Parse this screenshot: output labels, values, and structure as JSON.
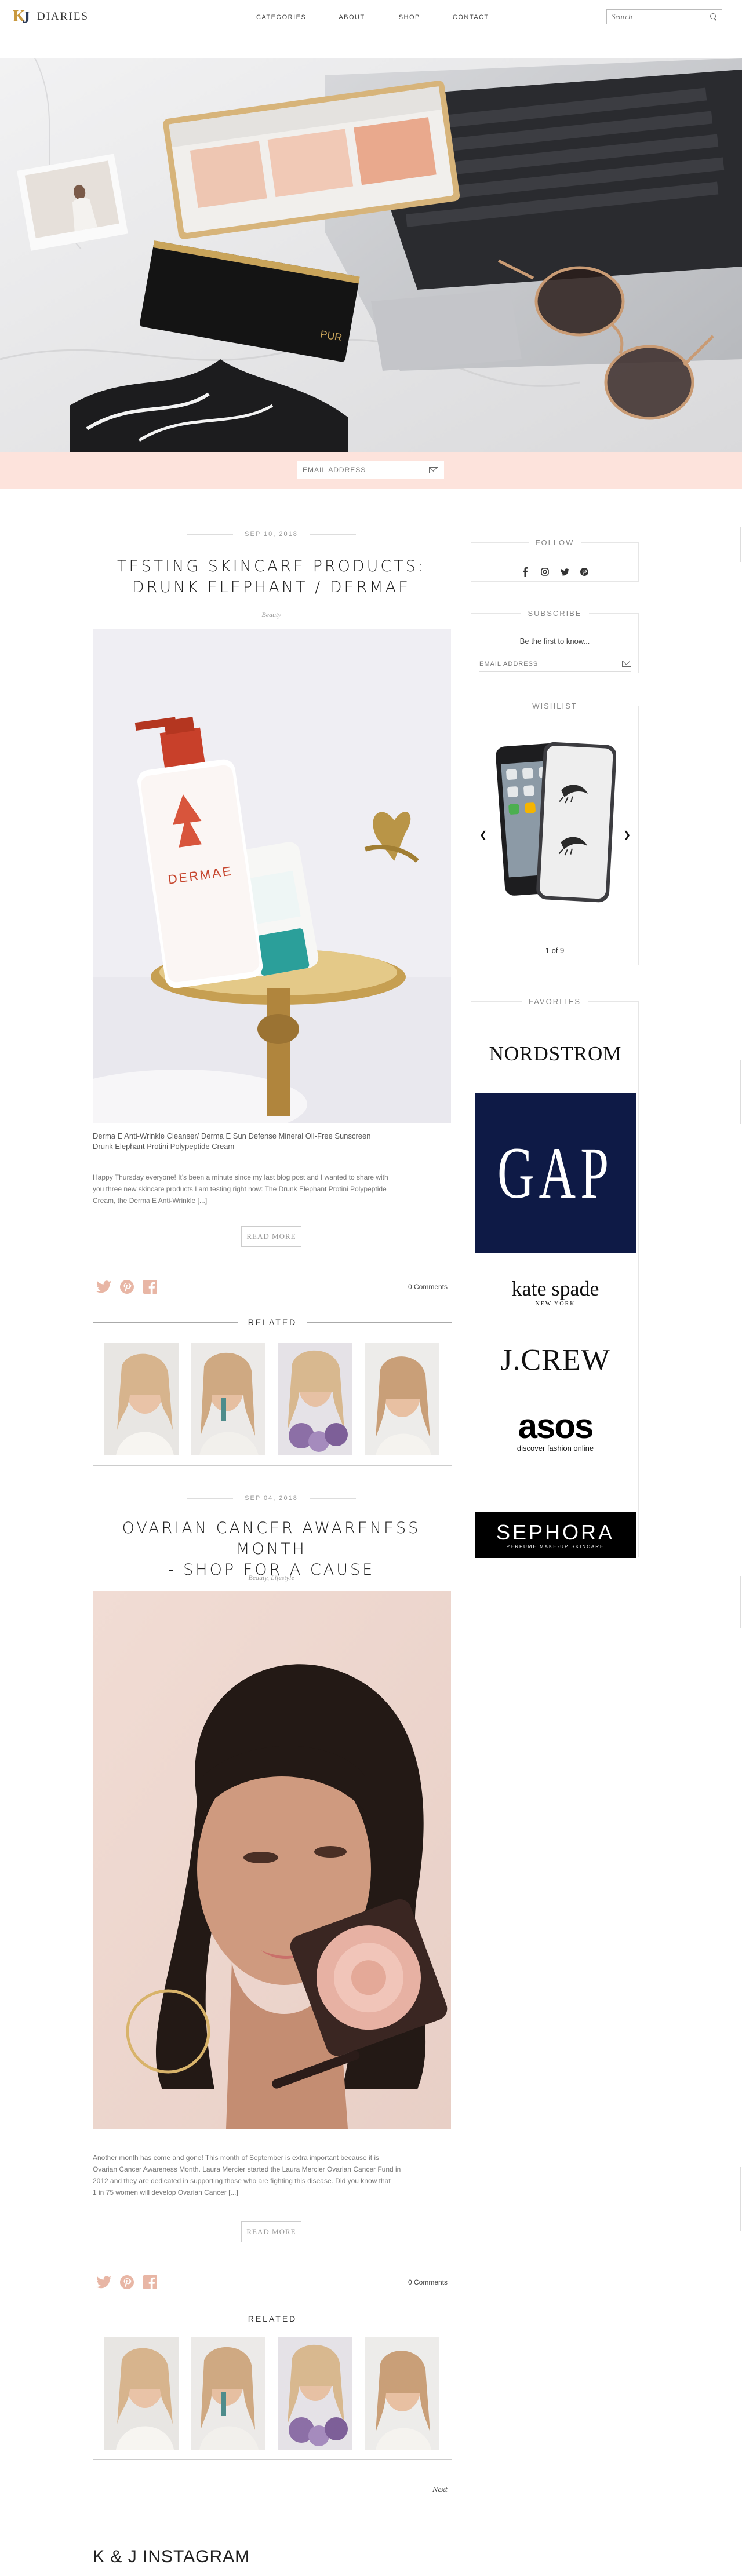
{
  "header": {
    "logo_mark_k": "K",
    "logo_mark_j": "J",
    "logo_text": "DIARIES",
    "nav": [
      "CATEGORIES",
      "ABOUT",
      "SHOP",
      "CONTACT"
    ],
    "search_placeholder": "Search"
  },
  "hero": {
    "palette_brand": "PUR",
    "email_placeholder": "EMAIL ADDRESS"
  },
  "posts": [
    {
      "date": "SEP 10, 2018",
      "title_line1": "TESTING SKINCARE PRODUCTS:",
      "title_line2": "DRUNK ELEPHANT / DERMAE",
      "category": "Beauty",
      "bottle_brand": "DERMAE",
      "caption_line1": "Derma E Anti-Wrinkle Cleanser/ Derma E Sun Defense Mineral Oil-Free Sunscreen",
      "caption_line2": "Drunk Elephant Protini Polypeptide Cream",
      "excerpt_line1": "Happy Thursday everyone! It's been a minute since my last blog post and I wanted to share with",
      "excerpt_line2": "you three new skincare products I am testing right now: The Drunk Elephant Protini Polypeptide",
      "excerpt_line3": "Cream, the Derma E Anti-Wrinkle [...]",
      "read_more": "READ MORE",
      "comments": "0 Comments",
      "related_label": "RELATED"
    },
    {
      "date": "SEP 04, 2018",
      "title_line1": "OVARIAN CANCER AWARENESS MONTH",
      "title_line2": "- SHOP FOR A CAUSE",
      "category": "Beauty, Lifestyle",
      "excerpt_line1": "Another month has come and gone! This month of September is extra important because it is",
      "excerpt_line2": "Ovarian Cancer Awareness Month. Laura Mercier started the Laura Mercier Ovarian Cancer Fund in",
      "excerpt_line3": "2012 and they are dedicated in supporting those who are fighting this disease. Did you know that",
      "excerpt_line4": "1 in 75 women will develop Ovarian Cancer [...]",
      "read_more": "READ MORE",
      "comments": "0 Comments",
      "related_label": "RELATED"
    }
  ],
  "sidebar": {
    "follow_title": "FOLLOW",
    "subscribe_title": "SUBSCRIBE",
    "subscribe_text": "Be the first to know...",
    "subscribe_placeholder": "EMAIL ADDRESS",
    "wishlist_title": "WISHLIST",
    "wishlist_counter": "1 of 9",
    "favorites_title": "FAVORITES",
    "brands": {
      "nordstrom": "NORDSTROM",
      "gap": "GAP",
      "katespade": "kate spade",
      "katespade_sub": "NEW YORK",
      "jcrew": "J.CREW",
      "asos": "asos",
      "asos_sub": "discover fashion online",
      "sephora": "SEPHORA",
      "sephora_sub": "PERFUME MAKE-UP SKINCARE"
    }
  },
  "footer": {
    "next_label": "Next",
    "instagram_title": "K & J INSTAGRAM"
  },
  "colors": {
    "accent_peach": "#fde3dc",
    "icon_peach": "#e8b6a5",
    "logo_gold": "#c9993f",
    "gap_navy": "#0e1a46"
  }
}
